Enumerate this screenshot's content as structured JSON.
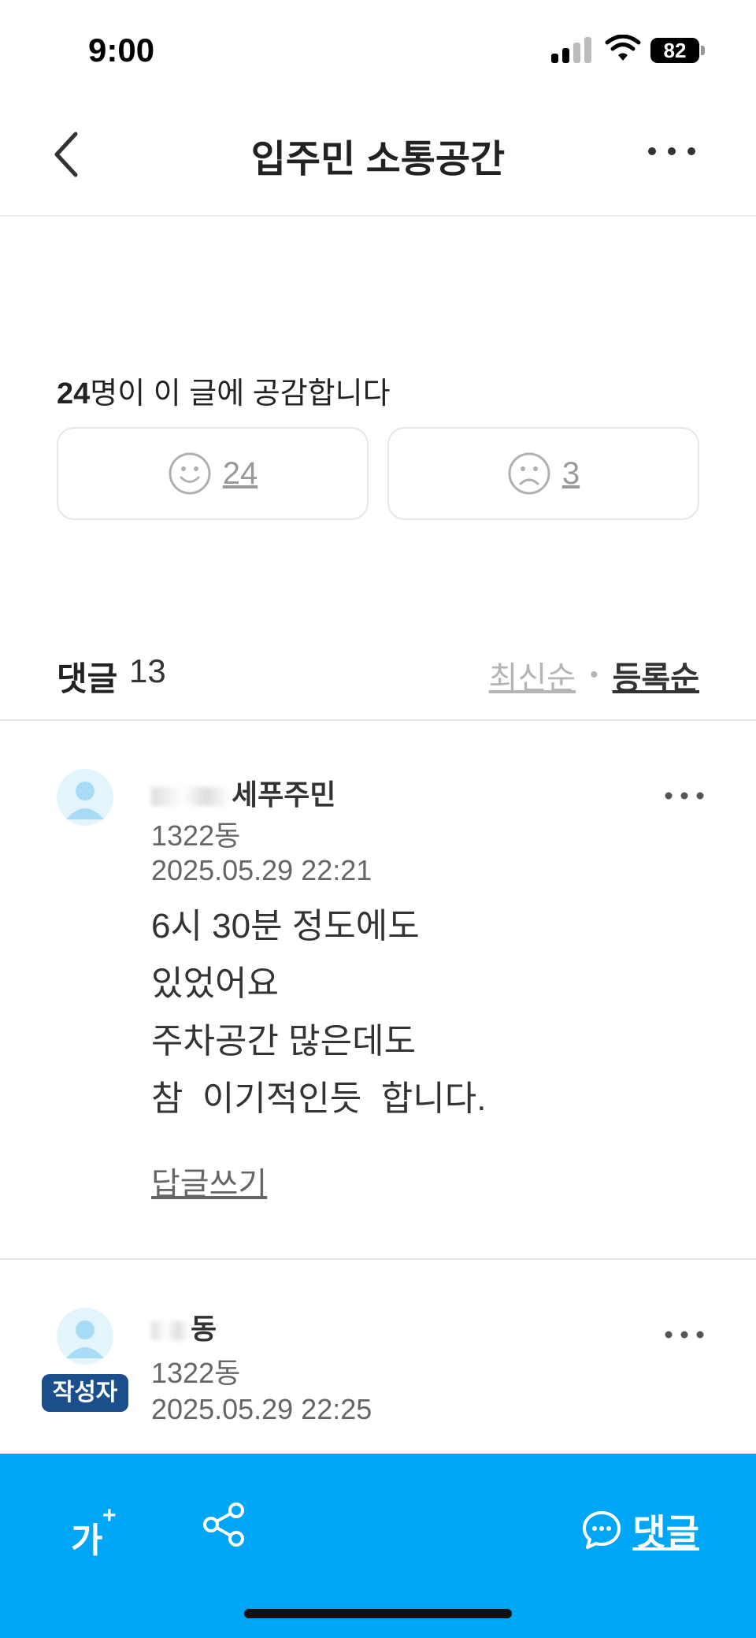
{
  "status_bar": {
    "time": "9:00",
    "battery": "82",
    "icons": [
      "signal-icon",
      "wifi-icon",
      "battery-icon"
    ]
  },
  "header": {
    "title": "입주민 소통공간",
    "back_icon": "chevron-left-icon",
    "more_icon": "more-horizontal-icon"
  },
  "empathy": {
    "count": "24",
    "suffix": "명이 이 글에 공감합니다",
    "like_count": "24",
    "dislike_count": "3"
  },
  "comments_section": {
    "title": "댓글",
    "count": "13",
    "sort_latest": "최신순",
    "sort_separator": "•",
    "sort_registered": "등록순"
  },
  "comments": [
    {
      "author": "세푸주민",
      "building": "1322동",
      "datetime": "2025.05.29 22:21",
      "lines": [
        "6시 30분 정도에도",
        "있었어요",
        "주차공간 많은데도",
        "참  이기적인듯  합니다."
      ],
      "reply_label": "답글쓰기"
    },
    {
      "author": "동",
      "badge": "작성자",
      "building": "1322동",
      "datetime": "2025.05.29 22:25"
    }
  ],
  "bottom_bar": {
    "font_size_label": "가",
    "font_size_plus": "+",
    "comment_label": "댓글",
    "icons": [
      "font-size-icon",
      "share-icon",
      "chat-bubble-icon"
    ]
  },
  "colors": {
    "accent": "#00a6f6",
    "badge": "#1b4f8c",
    "avatar_bg": "#e3f4fd"
  }
}
